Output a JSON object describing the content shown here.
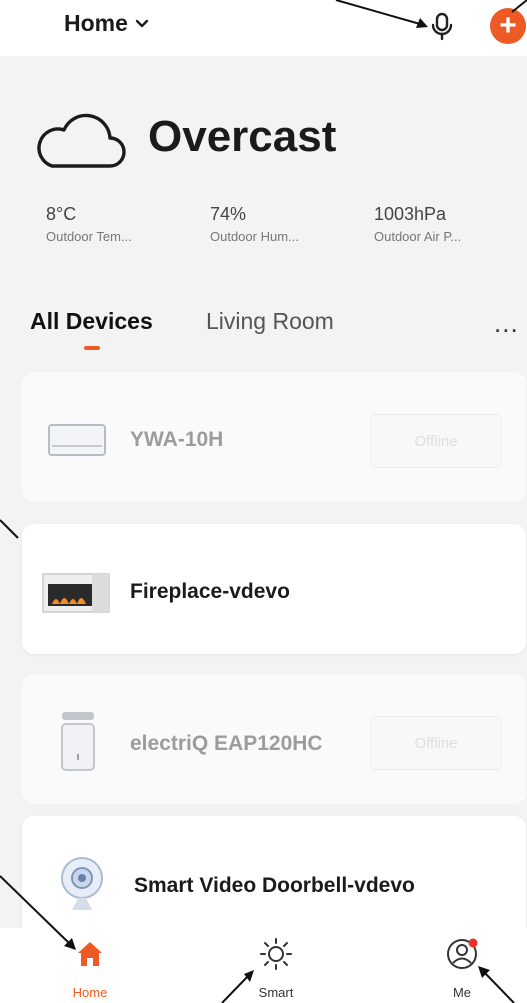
{
  "header": {
    "home_label": "Home",
    "chevron_icon": "chevron-down-icon",
    "mic_icon": "microphone-icon",
    "add_icon": "add-icon",
    "add_symbol": "+"
  },
  "weather": {
    "icon": "cloud-icon",
    "condition": "Overcast",
    "stats": [
      {
        "value": "8°C",
        "label": "Outdoor Tem..."
      },
      {
        "value": "74%",
        "label": "Outdoor Hum..."
      },
      {
        "value": "1003hPa",
        "label": "Outdoor Air P..."
      }
    ]
  },
  "tabs": {
    "items": [
      {
        "label": "All Devices",
        "active": true
      },
      {
        "label": "Living Room",
        "active": false
      }
    ],
    "more": "..."
  },
  "devices": [
    {
      "name": "YWA-10H",
      "status": "Offline",
      "icon": "air-conditioner-icon"
    },
    {
      "name": "Fireplace-vdevo",
      "status": "",
      "icon": "fireplace-icon"
    },
    {
      "name": "electriQ EAP120HC",
      "status": "Offline",
      "icon": "air-purifier-icon"
    },
    {
      "name": "Smart Video Doorbell-vdevo",
      "status": "",
      "icon": "camera-icon"
    }
  ],
  "bottom_nav": [
    {
      "label": "Home",
      "icon": "home-icon",
      "active": true
    },
    {
      "label": "Smart",
      "icon": "sun-icon",
      "active": false
    },
    {
      "label": "Me",
      "icon": "profile-icon",
      "active": false
    }
  ],
  "colors": {
    "accent": "#ee5a24",
    "background": "#f3f3f3",
    "card": "#ffffff"
  }
}
